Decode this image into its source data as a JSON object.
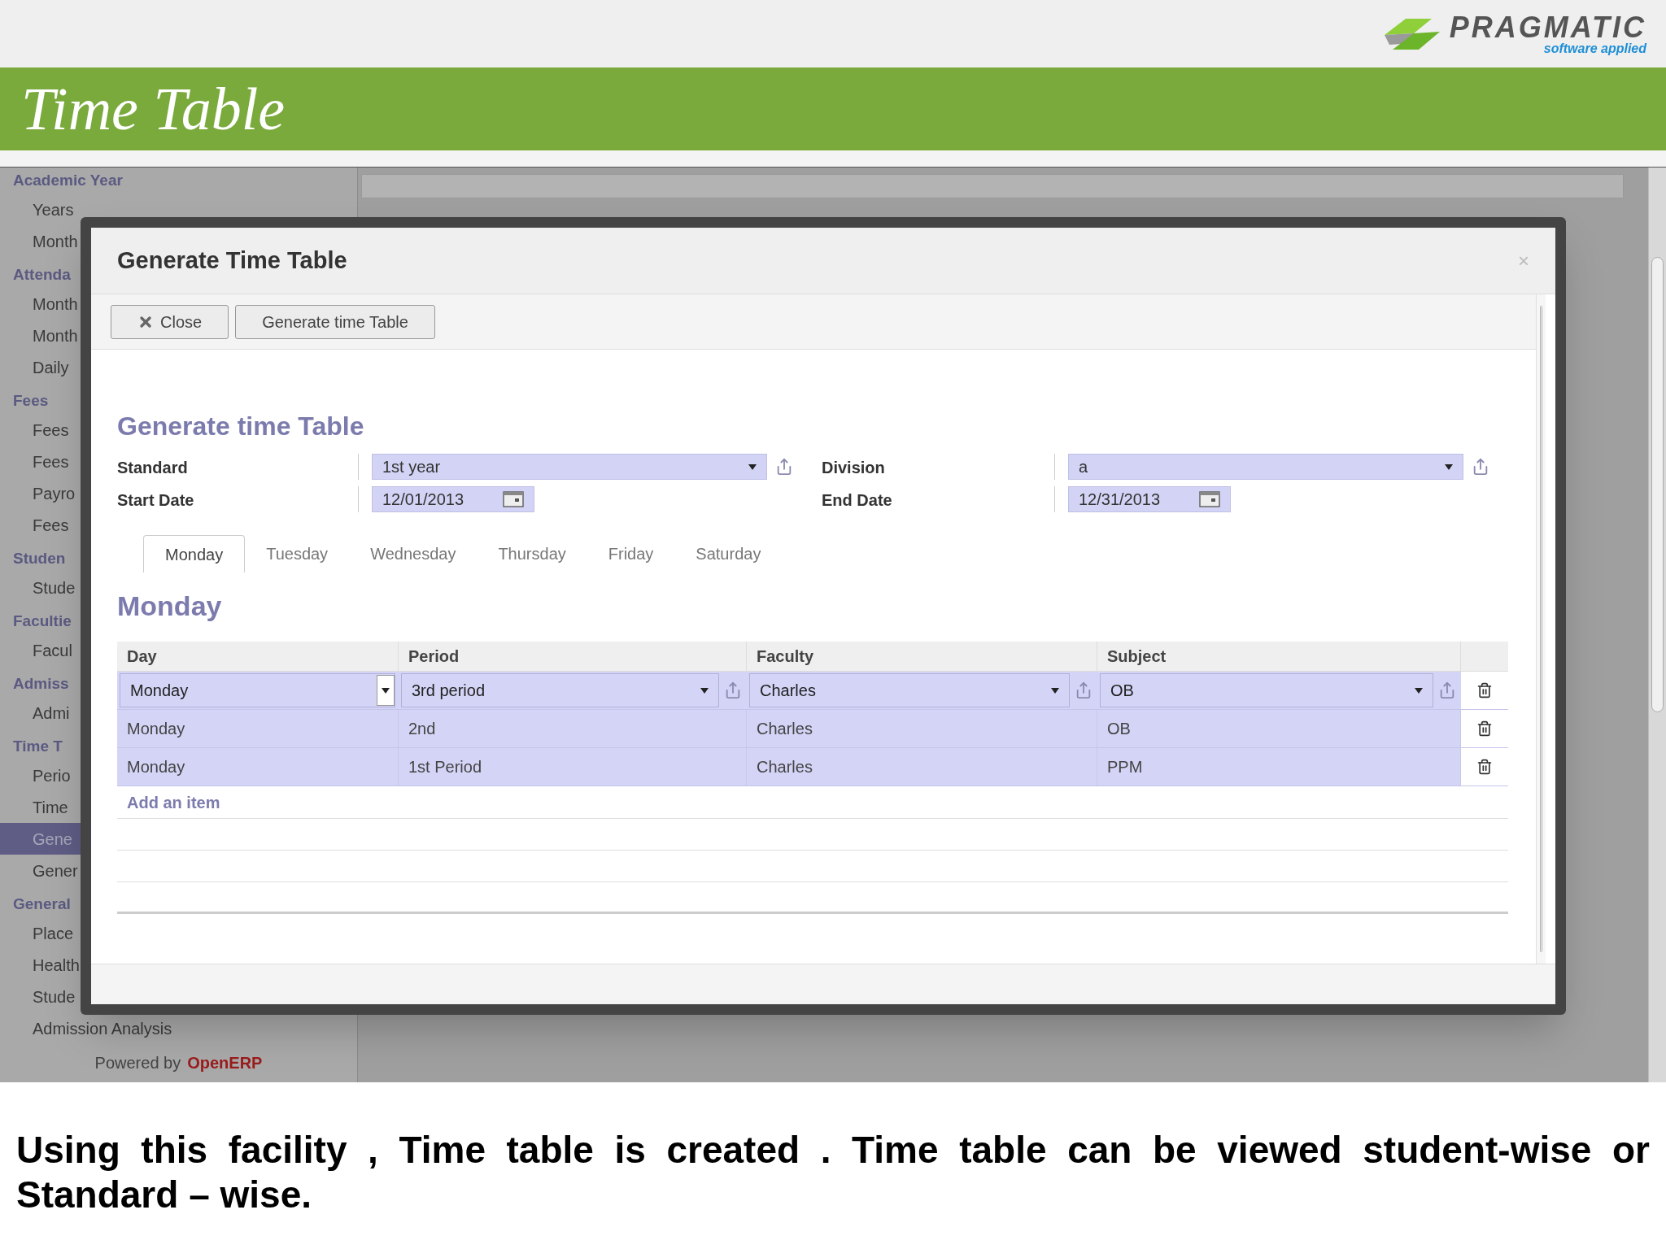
{
  "logo": {
    "name": "PRAGMATIC",
    "tagline": "software applied"
  },
  "banner": {
    "title": "Time Table"
  },
  "sidebar": {
    "sections": [
      {
        "title": "Academic Year",
        "items": [
          {
            "label": "Years",
            "selected": false
          },
          {
            "label": "Month",
            "selected": false
          }
        ]
      },
      {
        "title": "Attenda",
        "items": [
          {
            "label": "Month",
            "selected": false
          },
          {
            "label": "Month",
            "selected": false
          },
          {
            "label": "Daily",
            "selected": false
          }
        ]
      },
      {
        "title": "Fees",
        "items": [
          {
            "label": "Fees",
            "selected": false
          },
          {
            "label": "Fees",
            "selected": false
          },
          {
            "label": "Payro",
            "selected": false
          },
          {
            "label": "Fees",
            "selected": false
          }
        ]
      },
      {
        "title": "Studen",
        "items": [
          {
            "label": "Stude",
            "selected": false
          }
        ]
      },
      {
        "title": "Facultie",
        "items": [
          {
            "label": "Facul",
            "selected": false
          }
        ]
      },
      {
        "title": "Admiss",
        "items": [
          {
            "label": "Admi",
            "selected": false
          }
        ]
      },
      {
        "title": "Time T",
        "items": [
          {
            "label": "Perio",
            "selected": false
          },
          {
            "label": "Time",
            "selected": false
          },
          {
            "label": "Gene",
            "selected": true
          },
          {
            "label": "Gener",
            "selected": false
          }
        ]
      },
      {
        "title": "General",
        "items": [
          {
            "label": "Place",
            "selected": false
          },
          {
            "label": "Health",
            "selected": false
          },
          {
            "label": "Stude",
            "selected": false
          },
          {
            "label": "Admission Analysis",
            "selected": false
          }
        ]
      }
    ],
    "footer": {
      "prefix": "Powered by",
      "brand": "OpenERP"
    }
  },
  "dialog": {
    "title": "Generate Time Table",
    "close_glyph": "×",
    "buttons": [
      {
        "kind": "close",
        "label": "Close"
      },
      {
        "kind": "plain",
        "label": "Generate time Table"
      }
    ],
    "heading": "Generate time Table",
    "fields": [
      {
        "label": "Standard",
        "kind": "select",
        "value": "1st year"
      },
      {
        "label": "Division",
        "kind": "select",
        "value": "a"
      },
      {
        "label": "Start Date",
        "kind": "date",
        "value": "12/01/2013"
      },
      {
        "label": "End Date",
        "kind": "date",
        "value": "12/31/2013"
      }
    ],
    "tabs": [
      {
        "label": "Monday",
        "selected": true
      },
      {
        "label": "Tuesday",
        "selected": false
      },
      {
        "label": "Wednesday",
        "selected": false
      },
      {
        "label": "Thursday",
        "selected": false
      },
      {
        "label": "Friday",
        "selected": false
      },
      {
        "label": "Saturday",
        "selected": false
      }
    ],
    "section_title": "Monday",
    "table": {
      "columns": [
        "Day",
        "Period",
        "Faculty",
        "Subject"
      ],
      "rows": [
        {
          "kind": "edit",
          "cells": [
            "Monday",
            "3rd period",
            "Charles",
            "OB"
          ]
        },
        {
          "kind": "view",
          "cells": [
            "Monday",
            "2nd",
            "Charles",
            "OB"
          ]
        },
        {
          "kind": "view",
          "cells": [
            "Monday",
            "1st Period",
            "Charles",
            "PPM"
          ]
        }
      ],
      "add_link": "Add an item"
    }
  },
  "caption": "Using this facility , Time table is created .  Time table can be viewed student-wise or Standard – wise."
}
